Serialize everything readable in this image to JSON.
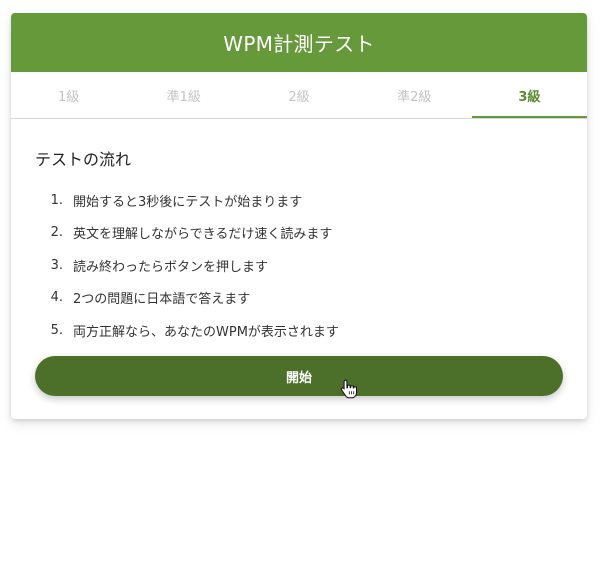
{
  "header": {
    "title": "WPM計測テスト"
  },
  "tabs": [
    {
      "label": "1級",
      "active": false
    },
    {
      "label": "準1級",
      "active": false
    },
    {
      "label": "2級",
      "active": false
    },
    {
      "label": "準2級",
      "active": false
    },
    {
      "label": "3級",
      "active": true
    }
  ],
  "main": {
    "section_title": "テストの流れ",
    "steps": [
      {
        "num": "1.",
        "text": "開始すると3秒後にテストが始まります"
      },
      {
        "num": "2.",
        "text": "英文を理解しながらできるだけ速く読みます"
      },
      {
        "num": "3.",
        "text": "読み終わったらボタンを押します"
      },
      {
        "num": "4.",
        "text": "2つの問題に日本語で答えます"
      },
      {
        "num": "5.",
        "text": "両方正解なら、あなたのWPMが表示されます"
      }
    ],
    "start_button": "開始"
  },
  "colors": {
    "header_bg": "#66993a",
    "button_bg": "#4c7029",
    "active_tab": "#5c8a33",
    "inactive_tab": "#c2c4c7"
  },
  "icons": {
    "cursor": "hand-pointer-icon"
  }
}
